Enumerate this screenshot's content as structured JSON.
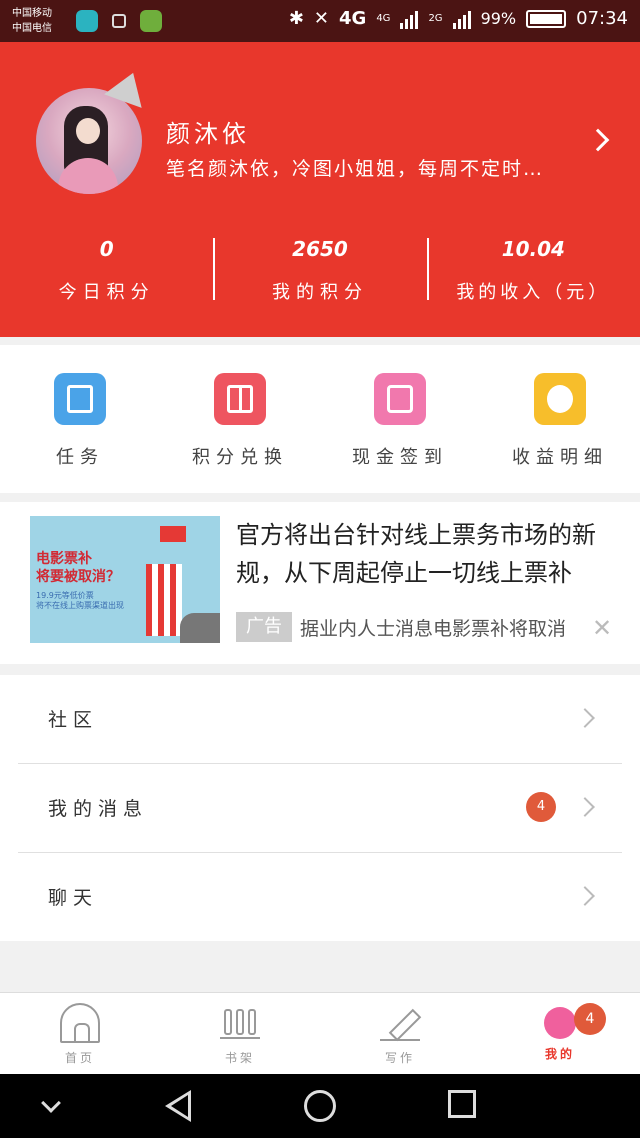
{
  "status_bar": {
    "carrier_1": "中国移动",
    "carrier_2": "中国电信",
    "network_1": "4G",
    "network_2": "4G",
    "network_3": "2G",
    "battery": "99%",
    "time": "07:34"
  },
  "profile": {
    "nickname": "颜沐依",
    "signature": "笔名颜沐依，冷图小姐姐，每周不定时…",
    "stats": [
      {
        "value": "0",
        "label": "今日积分"
      },
      {
        "value": "2650",
        "label": "我的积分"
      },
      {
        "value": "10.04",
        "label": "我的收入（元）"
      }
    ]
  },
  "quick_actions": [
    {
      "label": "任务",
      "icon": "task-icon",
      "color": "#4aa3e8"
    },
    {
      "label": "积分兑换",
      "icon": "gift-icon",
      "color": "#ee5560"
    },
    {
      "label": "现金签到",
      "icon": "heart-envelope-icon",
      "color": "#f178ad"
    },
    {
      "label": "收益明细",
      "icon": "piggy-face-icon",
      "color": "#f7be2b"
    }
  ],
  "ad": {
    "image_text": {
      "line1": "电影票补",
      "line2": "将要被取消？",
      "line3": "19.9元等低价票",
      "line4": "将不在线上购票渠道出现"
    },
    "title": "官方将出台针对线上票务市场的新规，从下周起停止一切线上票补",
    "tag": "广告",
    "description": "据业内人士消息电影票补将取消"
  },
  "menu": [
    {
      "label": "社区"
    },
    {
      "label": "我的消息",
      "badge": "4"
    },
    {
      "label": "聊天"
    }
  ],
  "tabbar": {
    "tabs": [
      {
        "label": "首页",
        "icon": "home-icon"
      },
      {
        "label": "书架",
        "icon": "bookshelf-icon"
      },
      {
        "label": "写作",
        "icon": "pen-icon"
      },
      {
        "label": "我的",
        "icon": "profile-icon",
        "badge": "4"
      }
    ]
  },
  "colors": {
    "accent": "#e8372c",
    "badge": "#e05a3a"
  }
}
